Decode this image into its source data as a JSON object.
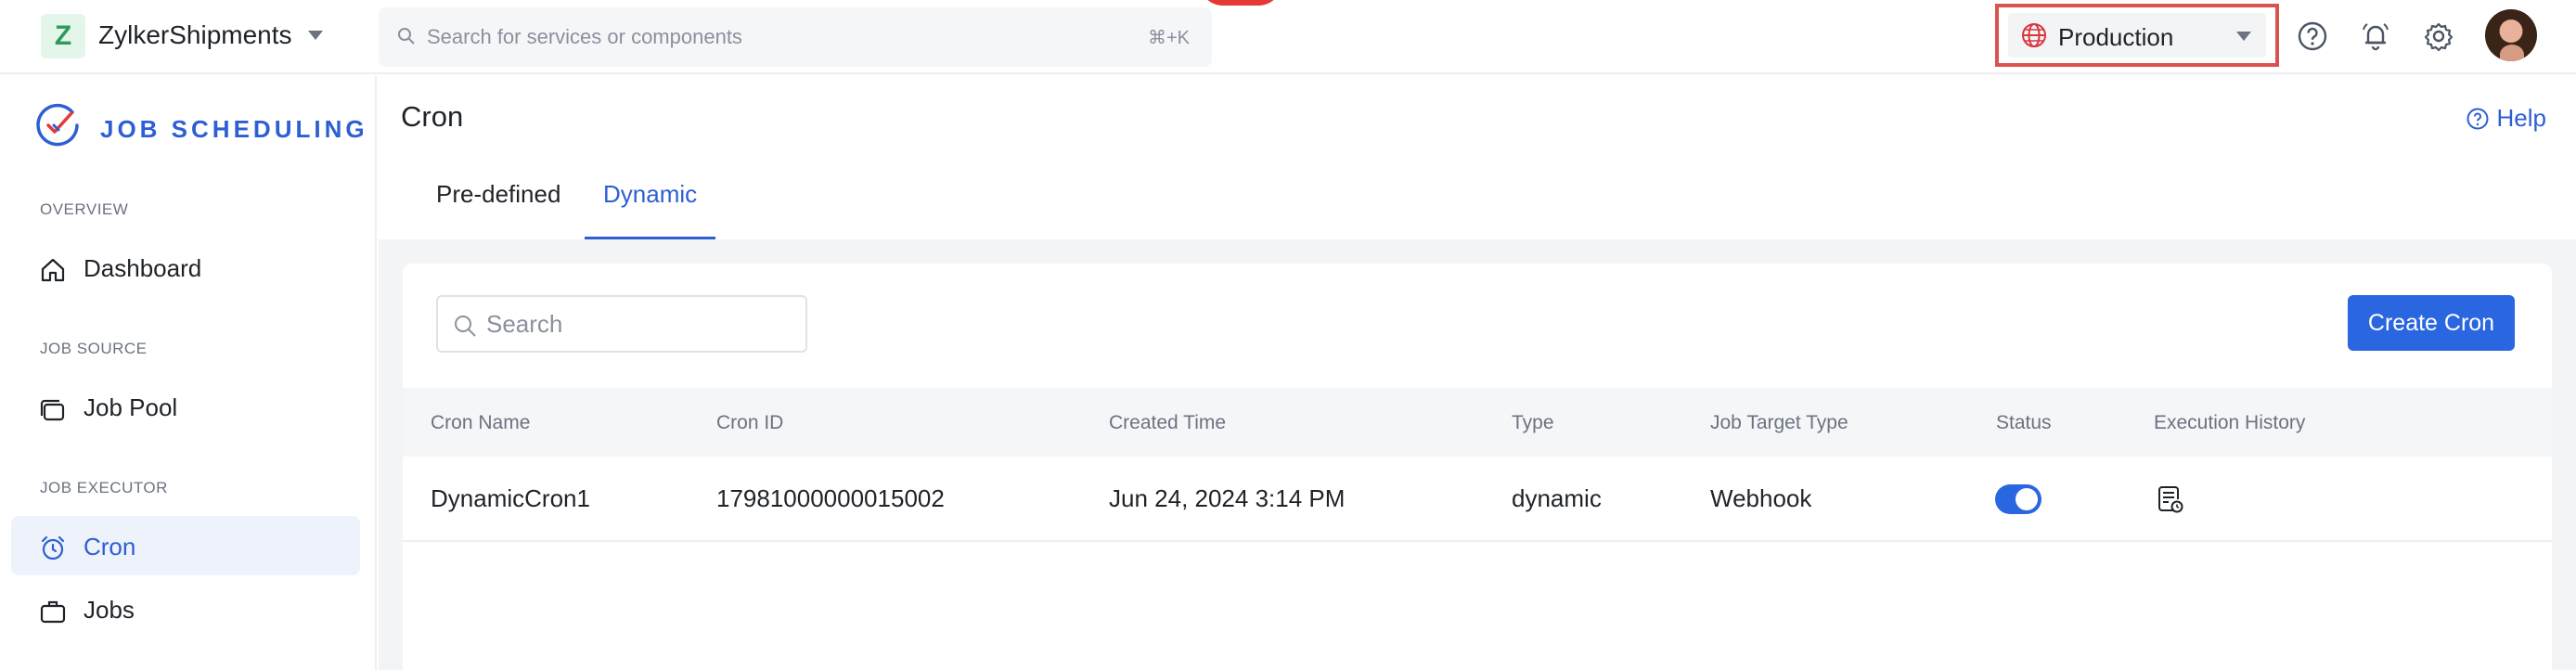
{
  "org": {
    "initial": "Z",
    "name": "ZylkerShipments"
  },
  "search": {
    "placeholder": "Search for services or components",
    "shortcut": "⌘+K"
  },
  "environment": {
    "label": "Production"
  },
  "topbar_icons": [
    "help-circle-icon",
    "bell-icon",
    "gear-icon"
  ],
  "sidebar": {
    "app_title": "JOB SCHEDULING",
    "sections": [
      {
        "label": "OVERVIEW",
        "items": [
          {
            "label": "Dashboard",
            "icon": "home-icon"
          }
        ]
      },
      {
        "label": "JOB SOURCE",
        "items": [
          {
            "label": "Job Pool",
            "icon": "stack-icon"
          }
        ]
      },
      {
        "label": "JOB EXECUTOR",
        "items": [
          {
            "label": "Cron",
            "icon": "alarm-clock-icon",
            "active": true
          },
          {
            "label": "Jobs",
            "icon": "briefcase-icon"
          }
        ]
      }
    ]
  },
  "main": {
    "title": "Cron",
    "help_label": "Help",
    "tabs": [
      {
        "label": "Pre-defined"
      },
      {
        "label": "Dynamic",
        "active": true
      }
    ],
    "table_search_placeholder": "Search",
    "create_button": "Create Cron",
    "table": {
      "columns": [
        "Cron Name",
        "Cron ID",
        "Created Time",
        "Type",
        "Job Target Type",
        "Status",
        "Execution History"
      ],
      "rows": [
        {
          "name": "DynamicCron1",
          "id": "17981000000015002",
          "created": "Jun 24, 2024 3:14 PM",
          "type": "dynamic",
          "target": "Webhook",
          "status_on": true
        }
      ]
    }
  },
  "colors": {
    "accent": "#2d5fd3",
    "button": "#2a66e0",
    "highlight_border": "#d9534f"
  }
}
